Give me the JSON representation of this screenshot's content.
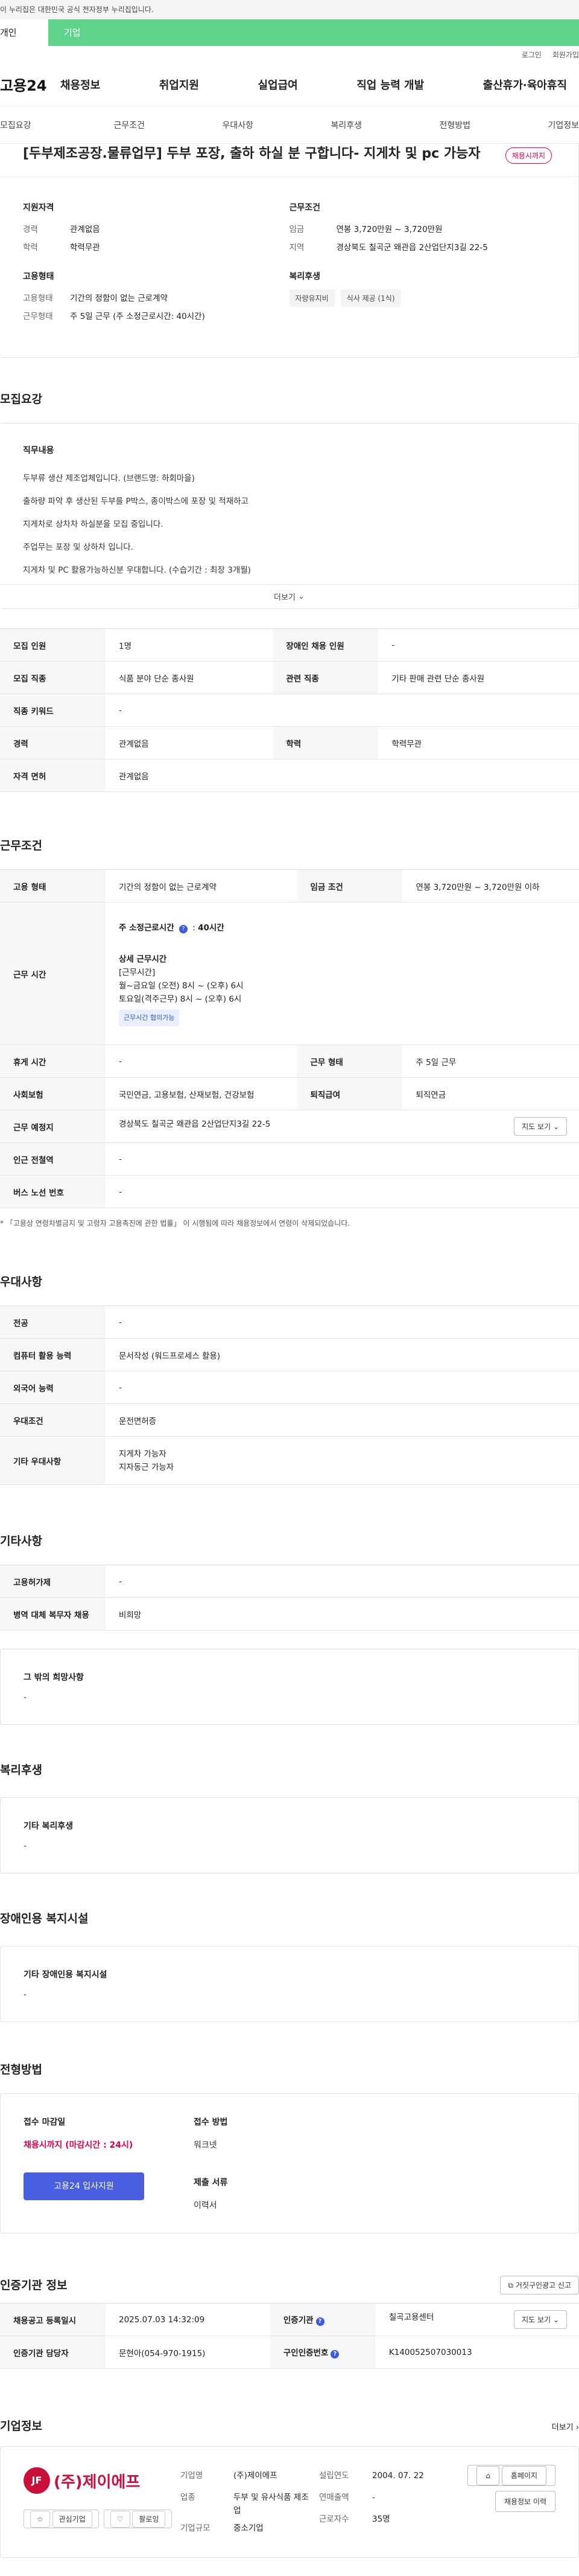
{
  "gov_banner": "이 누리집은 대한민국 공식 전자정부 누리집입니다.",
  "user_tabs": {
    "personal": "개인",
    "company": "기업"
  },
  "util_links": [
    "로그인",
    "회원가입"
  ],
  "logo": "고용24",
  "gnb": [
    "채용정보",
    "취업지원",
    "실업급여",
    "직업 능력 개발",
    "출산휴가·육아휴직"
  ],
  "subtabs": [
    "모집요강",
    "근무조건",
    "우대사항",
    "복리후생",
    "전형방법",
    "기업정보"
  ],
  "job": {
    "title": "[두부제조공장.물류업무] 두부 포장, 출하 하실 분 구합니다- 지게차 및 pc 가능자",
    "status_badge": "채용시까지"
  },
  "summary": {
    "qualification_title": "지원자격",
    "career_k": "경력",
    "career_v": "관계없음",
    "edu_k": "학력",
    "edu_v": "학력무관",
    "employ_title": "고용형태",
    "employ_k": "고용형태",
    "employ_v": "기간의 정함이 없는 근로계약",
    "hours_k": "근무형태",
    "hours_v": "주 5일 근무 (주 소정근로시간: 40시간)",
    "cond_title": "근무조건",
    "wage_k": "임금",
    "wage_v": "연봉 3,720만원 ~ 3,720만원",
    "region_k": "지역",
    "region_v": "경상북도 칠곡군 왜관읍 2산업단지3길 22-5",
    "welfare_title": "복리후생",
    "welfare_chips": [
      "자량유지비",
      "식사 제공 (1식)"
    ]
  },
  "recruit": {
    "title": "모집요강",
    "duty_label": "직무내용",
    "duty_lines": [
      "두부류 생산 제조업체입니다. (브랜드명: 하회마을)",
      "출하량 파악 후 생산된 두부를 P박스, 종이박스에 포장 및 적재하고",
      "지게차로 상차차 하실분을 모집 중입니다.",
      "주업무는 포장 및 상하차 입니다.",
      "지게차 및 PC 활용가능하신분 우대합니다. (수습기간 : 최장 3개월)"
    ],
    "more": "더보기",
    "rows": [
      {
        "k1": "모집 인원",
        "v1": "1명",
        "k2": "장애인 채용 인원",
        "v2": "-"
      },
      {
        "k1": "모집 직종",
        "v1": "식품 분야 단순 종사원",
        "k2": "관련 직종",
        "v2": "기타 판매 관련 단순 종사원"
      },
      {
        "k1": "직종 키워드",
        "v1": "-"
      },
      {
        "k1": "경력",
        "v1": "관계없음",
        "k2": "학력",
        "v2": "학력무관"
      },
      {
        "k1": "자격 면허",
        "v1": "관계없음"
      }
    ]
  },
  "work": {
    "title": "근무조건",
    "employ_k": "고용 형태",
    "employ_v": "기간의 정함이 없는 근로계약",
    "wage_k": "임금 조건",
    "wage_v": "연봉 3,720만원 ~ 3,720만원 이하",
    "time_k": "근무 시간",
    "time_std_label": "주 소정근로시간",
    "time_std_value": "40시간",
    "time_detail_label": "상세 근무시간",
    "time_lines": [
      "[근무시간]",
      "월~금요일 (오전) 8시 ~ (오후) 6시",
      "토요일(격주근무) 8시 ~ (오후) 6시"
    ],
    "time_badge": "근무시간 협의가능",
    "rest_k": "휴게 시간",
    "rest_v": "-",
    "form_k": "근무 형태",
    "form_v": "주 5일 근무",
    "ins_k": "사회보험",
    "ins_v": "국민연금, 고용보험, 산재보험, 건강보험",
    "retire_k": "퇴직급여",
    "retire_v": "퇴직연금",
    "place_k": "근무 예정지",
    "place_v": "경상북도 칠곡군 왜관읍 2산업단지3길 22-5",
    "map_btn": "지도 보기",
    "subway_k": "인근 전철역",
    "subway_v": "-",
    "bus_k": "버스 노선 번호",
    "bus_v": "-",
    "note": "* 「고용상 연령차별금지 및 고령자 고용촉진에 관한 법률」 이 시행됨에 따라 채용정보에서 연령이 삭제되었습니다."
  },
  "pref": {
    "title": "우대사항",
    "rows": [
      {
        "k": "전공",
        "v": "-"
      },
      {
        "k": "컴퓨터 활용 능력",
        "v": "문서작성 (워드프로세스 활용)"
      },
      {
        "k": "외국어 능력",
        "v": "-"
      },
      {
        "k": "우대조건",
        "v": "운전면허증"
      },
      {
        "k": "기타 우대사항",
        "v": "지게차 가능자\n지자동근 가능자"
      }
    ]
  },
  "etc": {
    "title": "기타사항",
    "rows": [
      {
        "k": "고용허가제",
        "v": "-"
      },
      {
        "k": "병역 대체 복무자 채용",
        "v": "비희망"
      }
    ],
    "other_label": "그 밖의 희망사항",
    "other_value": "-"
  },
  "welfare": {
    "title": "복리후생",
    "label": "기타 복리후생",
    "value": "-"
  },
  "disabled": {
    "title": "장애인용 복지시설",
    "label": "기타 장애인용 복지시설",
    "value": "-"
  },
  "process": {
    "title": "전형방법",
    "deadline_label": "접수 마감일",
    "deadline_value": "채용시까지 (마감시간 : 24시)",
    "apply_btn": "고용24 입사지원",
    "method_label": "접수 방법",
    "method_value": "워크넷",
    "docs_label": "제출 서류",
    "docs_value": "이력서"
  },
  "agency": {
    "title": "인증기관 정보",
    "report_btn": "거짓구인광고 신고",
    "reg_k": "채용공고 등록일시",
    "reg_v": "2025.07.03 14:32:09",
    "org_k": "인증기관",
    "org_v": "칠곡고용센터",
    "map_btn": "지도 보기",
    "mgr_k": "인증기관 담당자",
    "mgr_v": "문현아(054-970-1915)",
    "num_k": "구인인증번호",
    "num_v": "K140052507030013"
  },
  "company": {
    "title": "기업정보",
    "more": "더보기",
    "logo_text": "(주)제이에프",
    "logo_mark": "JF",
    "fav_btn": "관심기업",
    "follow_btn": "팔로잉",
    "name_k": "기업명",
    "name_v": "(주)제이에프",
    "biz_k": "업종",
    "biz_v": "두부 및 유사식품 제조업",
    "size_k": "기업규모",
    "size_v": "중소기업",
    "est_k": "설립연도",
    "est_v": "2004. 07. 22",
    "sales_k": "연매출액",
    "sales_v": "-",
    "emp_k": "근로자수",
    "emp_v": "35명",
    "homepage_btn": "홈페이지",
    "history_btn": "채용정보 이력"
  }
}
